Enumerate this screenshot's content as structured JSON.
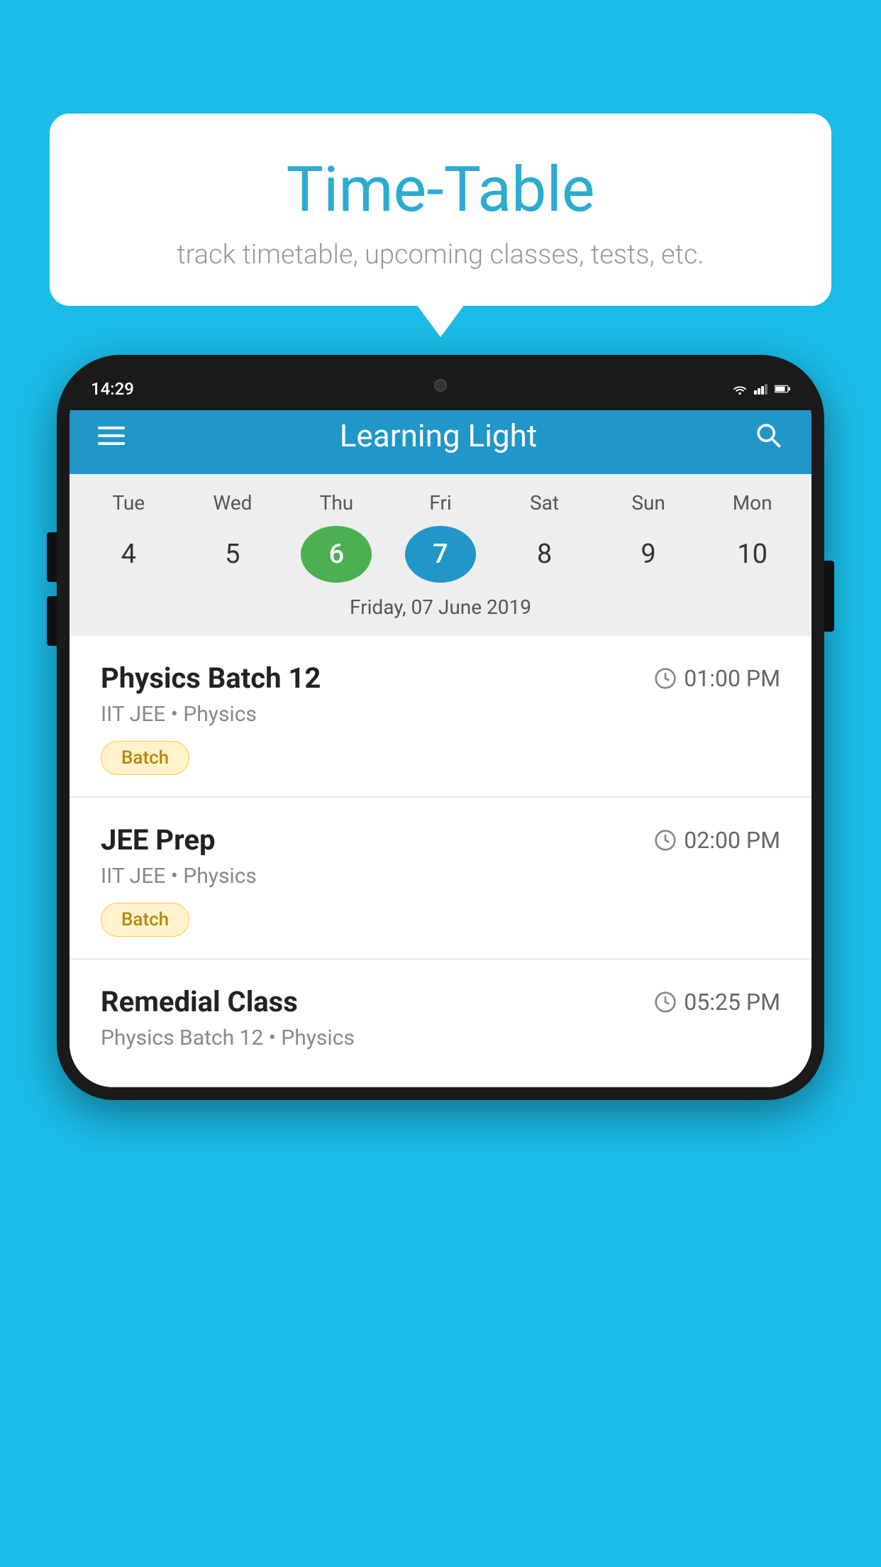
{
  "background": {
    "color": "#1BBCE8"
  },
  "tooltip": {
    "title": "Time-Table",
    "subtitle": "track timetable, upcoming classes, tests, etc."
  },
  "phone": {
    "status_bar": {
      "time": "14:29"
    },
    "app_bar": {
      "title": "Learning Light"
    },
    "calendar": {
      "days": [
        {
          "label": "Tue",
          "number": "4"
        },
        {
          "label": "Wed",
          "number": "5"
        },
        {
          "label": "Thu",
          "number": "6",
          "state": "today"
        },
        {
          "label": "Fri",
          "number": "7",
          "state": "selected"
        },
        {
          "label": "Sat",
          "number": "8"
        },
        {
          "label": "Sun",
          "number": "9"
        },
        {
          "label": "Mon",
          "number": "10"
        }
      ],
      "selected_date_label": "Friday, 07 June 2019"
    },
    "schedule_items": [
      {
        "title": "Physics Batch 12",
        "time": "01:00 PM",
        "subtitle": "IIT JEE • Physics",
        "badge": "Batch"
      },
      {
        "title": "JEE Prep",
        "time": "02:00 PM",
        "subtitle": "IIT JEE • Physics",
        "badge": "Batch"
      },
      {
        "title": "Remedial Class",
        "time": "05:25 PM",
        "subtitle": "Physics Batch 12 • Physics",
        "badge": null
      }
    ]
  }
}
